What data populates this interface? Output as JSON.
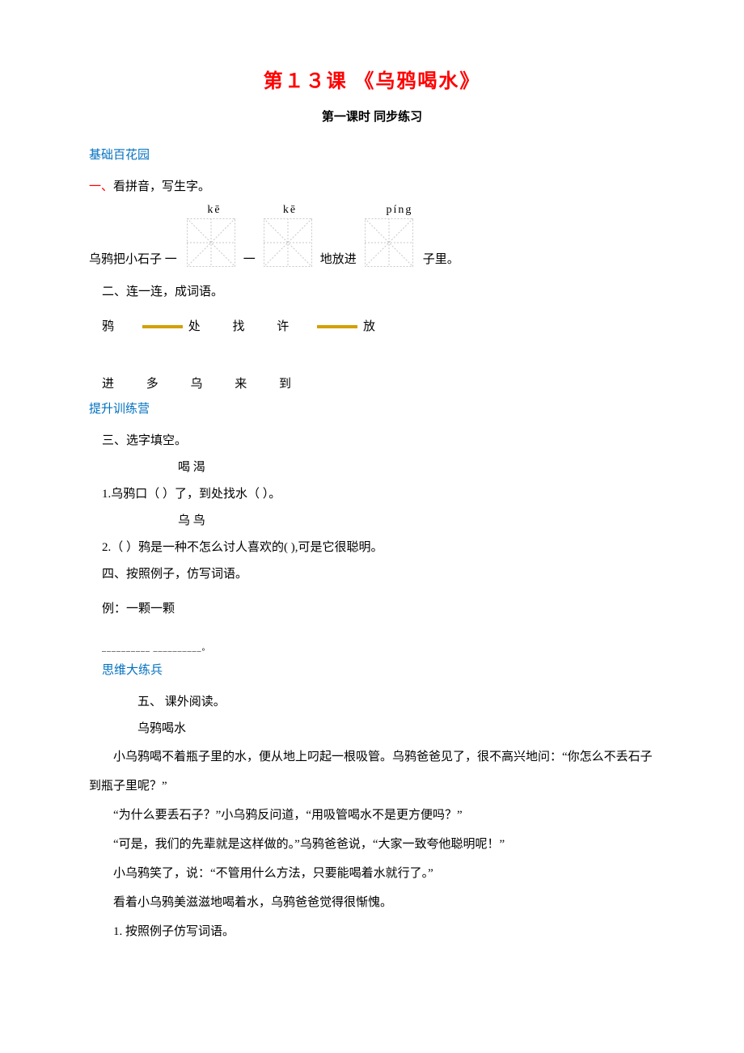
{
  "title": "第１３课 《乌鸦喝水》",
  "subtitle": "第一课时 同步练习",
  "sections": {
    "s1": {
      "heading": "基础百花园"
    },
    "s2": {
      "heading": "提升训练营"
    },
    "s3": {
      "heading": "思维大练兵"
    }
  },
  "q1": {
    "num": "一、",
    "label": "看拼音，写生字。",
    "pinyin": {
      "a": "kē",
      "b": "kē",
      "c": "píng"
    },
    "sentence_pre": "乌鸦把小石子 一",
    "between1": "一",
    "between2": "地放进",
    "after": "子里。"
  },
  "q2": {
    "label": "二、连一连，成词语。",
    "row1": {
      "a": "鸦",
      "b": "处",
      "c": "找",
      "d": "许",
      "e": "放"
    },
    "row2": {
      "a": "进",
      "b": "多",
      "c": "乌",
      "d": "来",
      "e": "到"
    }
  },
  "q3": {
    "label": "三、选字填空。",
    "pair1": "喝    渴",
    "item1": "1.乌鸦口（   ）了，到处找水（    ）。",
    "pair2": "乌    鸟",
    "item2": "2.（   ）鸦是一种不怎么讨人喜欢的(    ),可是它很聪明。"
  },
  "q4": {
    "label": "四、按照例子，仿写词语。",
    "example": "例：一颗一颗",
    "blanks": "__________    __________。"
  },
  "q5": {
    "label": "五、  课外阅读。",
    "story_title": "乌鸦喝水",
    "p1": "小乌鸦喝不着瓶子里的水，便从地上叼起一根吸管。乌鸦爸爸见了，很不高兴地问：“你怎么不丢石子到瓶子里呢？”",
    "p2": "“为什么要丢石子？”小乌鸦反问道，“用吸管喝水不是更方便吗？”",
    "p3": "“可是，我们的先辈就是这样做的。”乌鸦爸爸说，“大家一致夸他聪明呢！”",
    "p4": "小乌鸦笑了，说：“不管用什么方法，只要能喝着水就行了。”",
    "p5": "看着小乌鸦美滋滋地喝着水，乌鸦爸爸觉得很惭愧。",
    "sub1": "1. 按照例子仿写词语。"
  }
}
